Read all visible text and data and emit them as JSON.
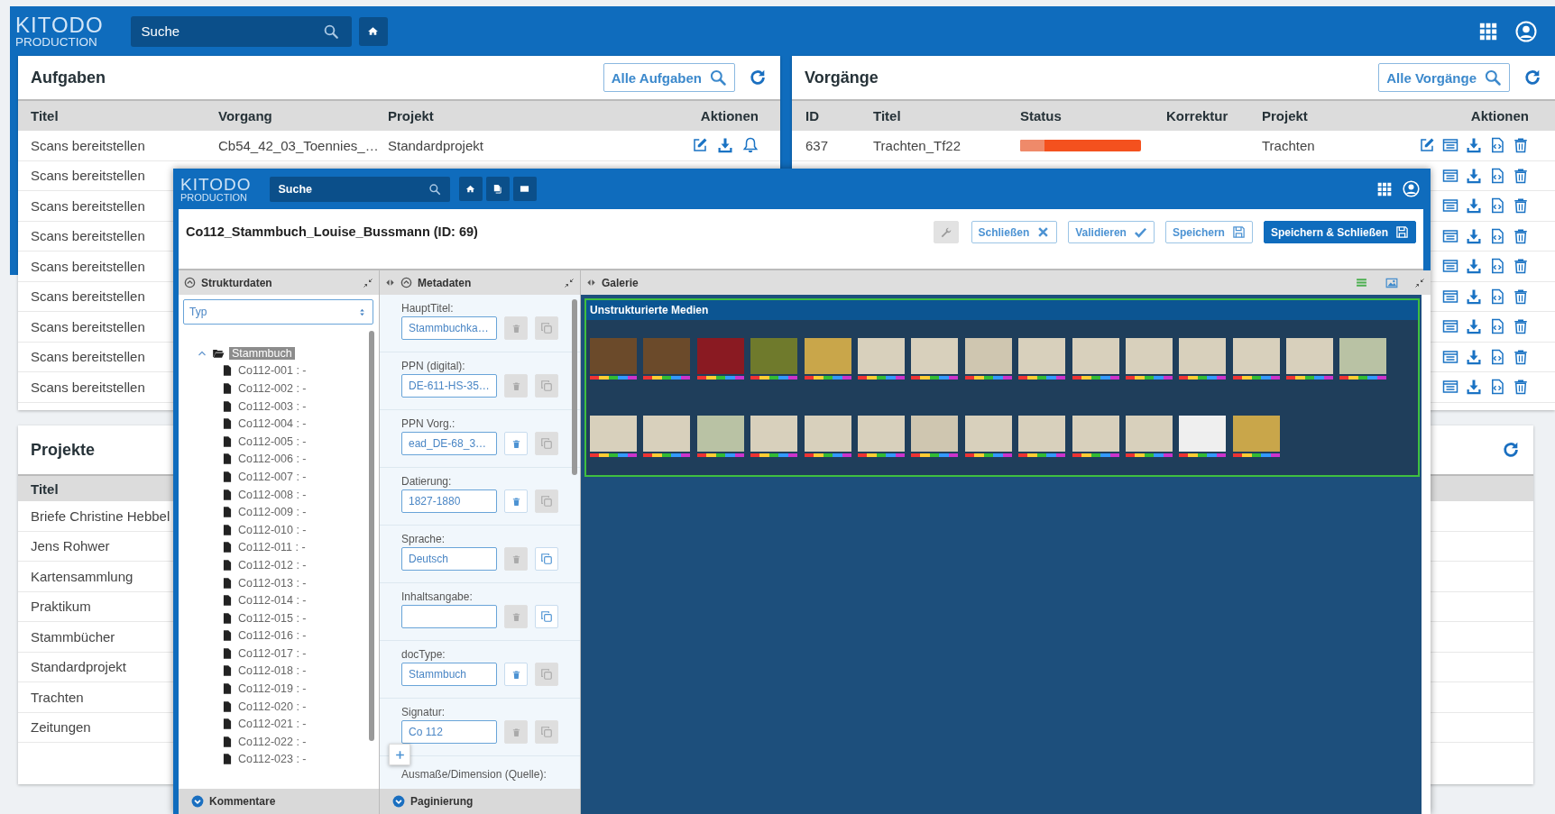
{
  "main_header": {
    "logo_wordmark": "KITODO",
    "logo_subtitle": "PRODUCTION",
    "search_placeholder": "Suche"
  },
  "aufgaben": {
    "title": "Aufgaben",
    "filter_button": "Alle Aufgaben",
    "columns": [
      "Titel",
      "Vorgang",
      "Projekt",
      "Aktionen"
    ],
    "rows": [
      {
        "titel": "Scans bereitstellen",
        "vorgang": "Cb54_42_03_Toennies_…",
        "projekt": "Standardprojekt"
      },
      {
        "titel": "Scans bereitstellen"
      },
      {
        "titel": "Scans bereitstellen"
      },
      {
        "titel": "Scans bereitstellen"
      },
      {
        "titel": "Scans bereitstellen"
      },
      {
        "titel": "Scans bereitstellen"
      },
      {
        "titel": "Scans bereitstellen"
      },
      {
        "titel": "Scans bereitstellen"
      },
      {
        "titel": "Scans bereitstellen"
      }
    ]
  },
  "vorgaenge": {
    "title": "Vorgänge",
    "filter_button": "Alle Vorgänge",
    "columns": [
      "ID",
      "Titel",
      "Status",
      "Korrektur",
      "Projekt",
      "Aktionen"
    ],
    "rows": [
      {
        "id": "637",
        "titel": "Trachten_Tf22",
        "level": 0.2,
        "projekt": "Trachten",
        "covered": false
      },
      {
        "covered": true
      },
      {
        "covered": true
      },
      {
        "covered": true
      },
      {
        "covered": true
      },
      {
        "covered": true
      },
      {
        "covered": true
      },
      {
        "covered": true
      },
      {
        "covered": true
      }
    ]
  },
  "projekte": {
    "title": "Projekte",
    "columns": [
      "Titel"
    ],
    "rows": [
      "Briefe Christine Hebbel",
      "Jens Rohwer",
      "Kartensammlung",
      "Praktikum",
      "Stammbücher",
      "Standardprojekt",
      "Trachten",
      "Zeitungen"
    ]
  },
  "editor": {
    "header": {
      "logo_wordmark": "KITODO",
      "logo_subtitle": "PRODUCTION",
      "search_placeholder": "Suche"
    },
    "title": "Co112_Stammbuch_Louise_Bussmann (ID: 69)",
    "buttons": [
      {
        "kind": "tool",
        "disabled": true
      },
      {
        "kind": "close",
        "label": "Schließen",
        "disabled": false
      },
      {
        "kind": "validate",
        "label": "Validieren",
        "disabled": false
      },
      {
        "kind": "save",
        "label": "Speichern",
        "disabled": false
      },
      {
        "kind": "save_close",
        "label": "Speichern & Schließen",
        "disabled": false
      }
    ],
    "struktur": {
      "title": "Strukturdaten",
      "type_select": "Typ",
      "footer": "Kommentare",
      "tree": [
        {
          "label": "Stammbuch",
          "selected": true,
          "expanded": true,
          "children": [
            {
              "label": "Co112-001 : -",
              "selected": false
            },
            {
              "label": "Co112-002 : -",
              "selected": false
            },
            {
              "label": "Co112-003 : -",
              "selected": false
            },
            {
              "label": "Co112-004 : -",
              "selected": false
            },
            {
              "label": "Co112-005 : -",
              "selected": false
            },
            {
              "label": "Co112-006 : -",
              "selected": false
            },
            {
              "label": "Co112-007 : -",
              "selected": false
            },
            {
              "label": "Co112-008 : -",
              "selected": false
            },
            {
              "label": "Co112-009 : -",
              "selected": false
            },
            {
              "label": "Co112-010 : -",
              "selected": false
            },
            {
              "label": "Co112-011 : -",
              "selected": false
            },
            {
              "label": "Co112-012 : -",
              "selected": false
            },
            {
              "label": "Co112-013 : -",
              "selected": false
            },
            {
              "label": "Co112-014 : -",
              "selected": false
            },
            {
              "label": "Co112-015 : -",
              "selected": false
            },
            {
              "label": "Co112-016 : -",
              "selected": false
            },
            {
              "label": "Co112-017 : -",
              "selected": false
            },
            {
              "label": "Co112-018 : -",
              "selected": false
            },
            {
              "label": "Co112-019 : -",
              "selected": false
            },
            {
              "label": "Co112-020 : -",
              "selected": false
            },
            {
              "label": "Co112-021 : -",
              "selected": false
            },
            {
              "label": "Co112-022 : -",
              "selected": false
            },
            {
              "label": "Co112-023 : -",
              "selected": false
            }
          ]
        }
      ]
    },
    "metadaten": {
      "title": "Metadaten",
      "footer": "Paginierung",
      "last_label": "Ausmaße/Dimension (Quelle):",
      "fields": [
        {
          "label": "HauptTitel:",
          "value": "Stammbuchka…",
          "delete_enabled": false,
          "copy_enabled": false
        },
        {
          "label": "PPN (digital):",
          "value": "DE-611-HS-35…",
          "delete_enabled": false,
          "copy_enabled": false
        },
        {
          "label": "PPN Vorg.:",
          "value": "ead_DE-68_3…",
          "delete_enabled": true,
          "copy_enabled": false
        },
        {
          "label": "Datierung:",
          "value": "1827-1880",
          "delete_enabled": true,
          "copy_enabled": false
        },
        {
          "label": "Sprache:",
          "value": "Deutsch",
          "delete_enabled": false,
          "copy_enabled": true
        },
        {
          "label": "Inhaltsangabe:",
          "delete_enabled": false,
          "copy_enabled": true
        },
        {
          "label": "docType:",
          "value": "Stammbuch",
          "delete_enabled": true,
          "copy_enabled": false
        },
        {
          "label": "Signatur:",
          "value": "Co 112",
          "delete_enabled": false,
          "copy_enabled": false
        }
      ]
    },
    "galerie": {
      "title": "Galerie",
      "stripe_title": "Unstrukturierte Medien",
      "media": [
        {
          "kind": "cover"
        },
        {
          "kind": "cover"
        },
        {
          "kind": "binding"
        },
        {
          "kind": "spine"
        },
        {
          "kind": "case"
        },
        {
          "kind": "page"
        },
        {
          "kind": "page"
        },
        {
          "kind": "sketch"
        },
        {
          "kind": "page"
        },
        {
          "kind": "page"
        },
        {
          "kind": "page"
        },
        {
          "kind": "page"
        },
        {
          "kind": "page"
        },
        {
          "kind": "page"
        },
        {
          "kind": "landscape"
        },
        {
          "kind": "page"
        },
        {
          "kind": "page"
        },
        {
          "kind": "landscape"
        },
        {
          "kind": "page"
        },
        {
          "kind": "page"
        },
        {
          "kind": "page"
        },
        {
          "kind": "sketch"
        },
        {
          "kind": "page"
        },
        {
          "kind": "page"
        },
        {
          "kind": "page"
        },
        {
          "kind": "page"
        },
        {
          "kind": "silhouette"
        },
        {
          "kind": "case"
        }
      ]
    }
  }
}
